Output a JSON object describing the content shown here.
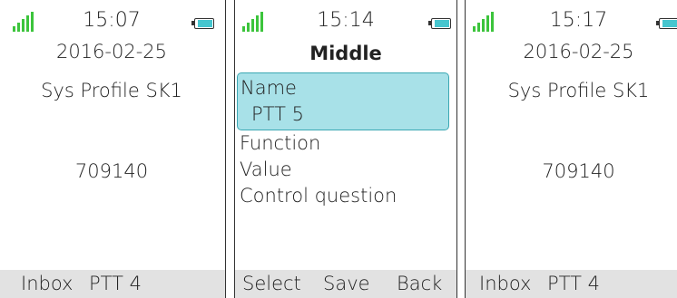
{
  "colors": {
    "signal": "#3cc43c",
    "battery": "#46c6cf",
    "selection": "#a8e1e8",
    "softkey_bar": "#e2e2e2"
  },
  "screens": [
    {
      "status": {
        "time": "15:07",
        "signal_icon": "signal-bars-icon",
        "battery_icon": "battery-icon"
      },
      "date": "2016-02-25",
      "profile": "Sys Profile SK1",
      "number": "709140",
      "softkeys": {
        "left": "Inbox",
        "middle": "PTT 4"
      }
    },
    {
      "status": {
        "time": "15:14",
        "signal_icon": "signal-bars-icon",
        "battery_icon": "battery-icon"
      },
      "title": "Middle",
      "menu": [
        {
          "label": "Name",
          "value": "PTT 5",
          "selected": true
        },
        {
          "label": "Function"
        },
        {
          "label": "Value"
        },
        {
          "label": "Control question"
        }
      ],
      "softkeys": {
        "left": "Select",
        "middle": "Save",
        "right": "Back"
      }
    },
    {
      "status": {
        "time": "15:17",
        "signal_icon": "signal-bars-icon",
        "battery_icon": "battery-icon"
      },
      "date": "2016-02-25",
      "profile": "Sys Profile SK1",
      "number": "709140",
      "softkeys": {
        "left": "Inbox",
        "middle": "PTT 4"
      }
    }
  ]
}
